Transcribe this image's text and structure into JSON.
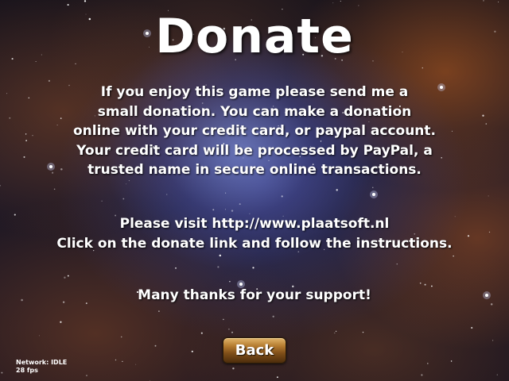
{
  "screen": {
    "title": "Donate",
    "intro_lines": [
      "If you enjoy this game please send me a",
      "small donation. You can make a donation",
      "online with your credit card, or paypal account.",
      "Your credit card will be processed by PayPal, a",
      "trusted name in secure online transactions."
    ],
    "visit_lines": [
      "Please visit http://www.plaatsoft.nl",
      "Click on the donate link and follow the instructions."
    ],
    "thanks": "Many thanks for your support!",
    "back_label": "Back"
  },
  "status": {
    "network": "Network: IDLE",
    "fps": "28 fps"
  },
  "colors": {
    "text": "#ffffff",
    "button_light": "#e2b56a",
    "button_dark": "#4d2d0c"
  }
}
